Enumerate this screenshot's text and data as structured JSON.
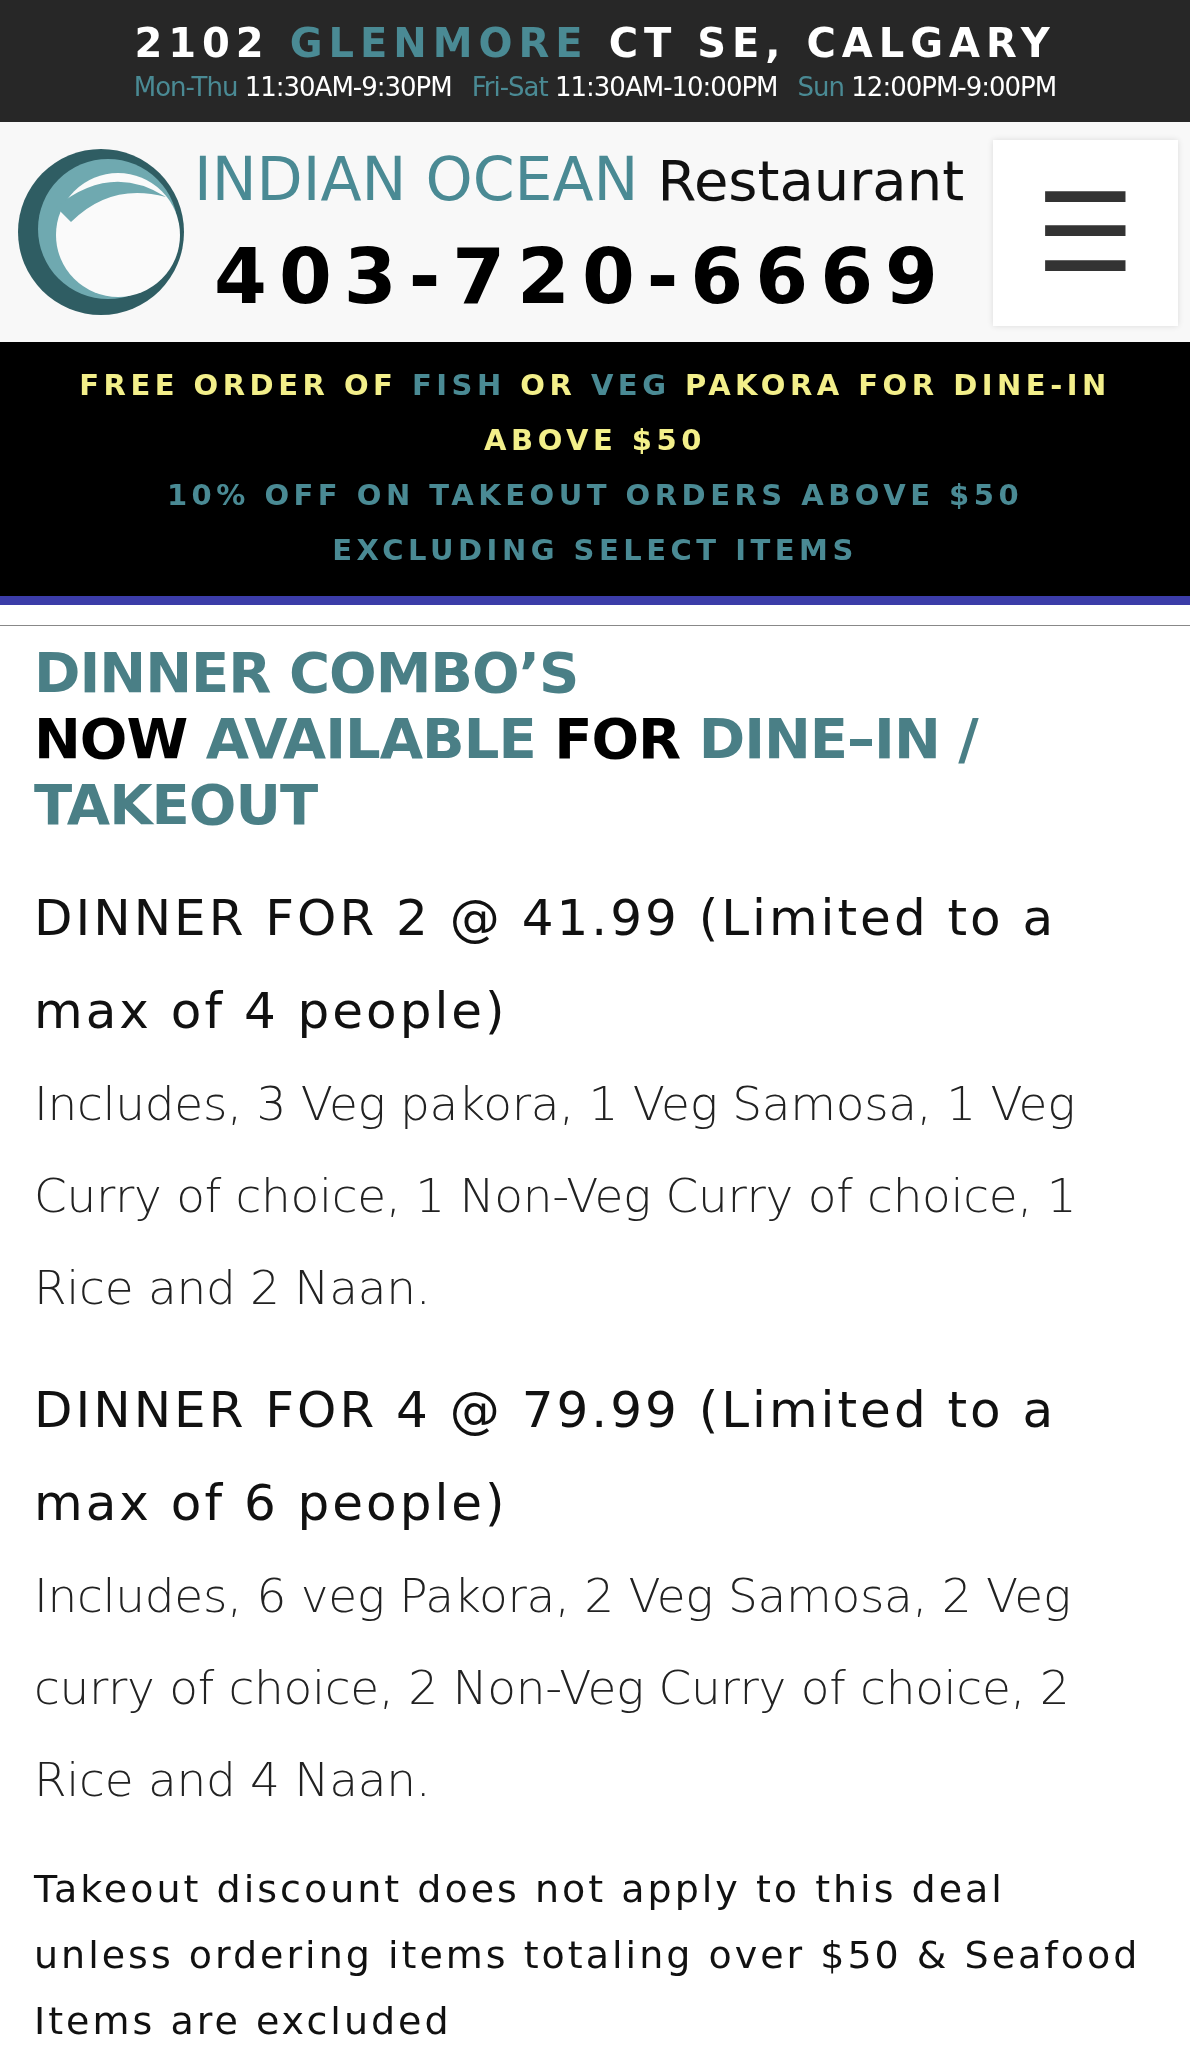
{
  "top_bar": {
    "address": [
      {
        "text": "2102 ",
        "accent": false
      },
      {
        "text": "GLENMORE",
        "accent": true
      },
      {
        "text": " CT SE, CALGARY",
        "accent": false
      }
    ],
    "hours": [
      {
        "days": "Mon-Thu",
        "time": "11:30AM-9:30PM"
      },
      {
        "days": "Fri-Sat",
        "time": "11:30AM-10:00PM"
      },
      {
        "days": "Sun",
        "time": "12:00PM-9:00PM"
      }
    ]
  },
  "header": {
    "brand": "INDIAN OCEAN",
    "brand_suffix": "Restaurant",
    "phone": "403-720-6669",
    "menu_icon": "☰"
  },
  "promo": [
    {
      "segments": [
        {
          "text": "FREE ORDER OF ",
          "accent": false
        },
        {
          "text": "FISH",
          "accent": true
        },
        {
          "text": " OR ",
          "accent": false
        },
        {
          "text": "VEG",
          "accent": true
        },
        {
          "text": " PAKORA FOR DINE-IN ABOVE $50",
          "accent": false
        }
      ],
      "kind": "yellow"
    },
    {
      "text": "10% OFF ON TAKEOUT ORDERS ABOVE $50 EXCLUDING SELECT ITEMS",
      "kind": "teal"
    }
  ],
  "heading": {
    "line1": "DINNER COMBO’S",
    "line2": [
      {
        "text": "NOW ",
        "accent": false
      },
      {
        "text": "AVAILABLE",
        "accent": true
      },
      {
        "text": " FOR ",
        "accent": false
      },
      {
        "text": "DINE–IN / TAKEOUT",
        "accent": true
      }
    ]
  },
  "offers": [
    {
      "title": "DINNER FOR 2 @ 41.99 (Limited to a max of 4 people)",
      "description": "Includes, 3 Veg pakora, 1 Veg Samosa, 1 Veg Curry of choice, 1 Non-Veg Curry of choice, 1 Rice and 2 Naan."
    },
    {
      "title": "DINNER FOR 4 @ 79.99 (Limited to a max of 6 people)",
      "description": "Includes, 6 veg Pakora, 2 Veg Samosa, 2 Veg curry of choice, 2 Non-Veg Curry of choice, 2 Rice and 4 Naan."
    }
  ],
  "note": "Takeout discount does not apply to this deal unless ordering items totaling over $50 & Seafood Items are excluded"
}
